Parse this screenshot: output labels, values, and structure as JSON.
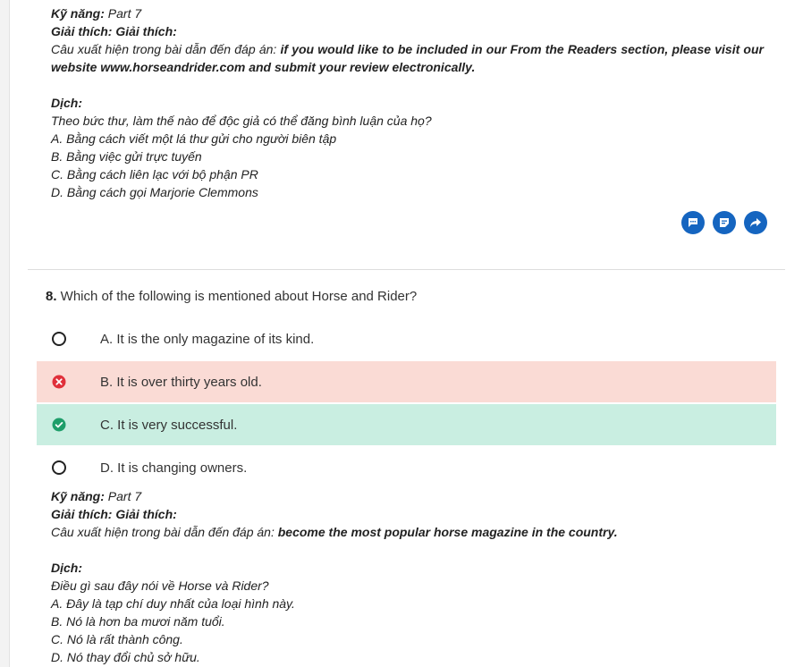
{
  "q7_explain": {
    "skill_label": "Kỹ năng:",
    "skill_value": " Part 7",
    "explain_label": "Giải thích: Giải thích:",
    "evidence_prefix": "Câu xuất hiện trong bài dẫn đến đáp án: ",
    "evidence_text": "if you would like to be included in our From the Readers section, please visit our website www.horseandrider.com and submit your review electronically.",
    "translation_label": "Dịch:",
    "translation_lines": [
      "Theo bức thư, làm thế nào để độc giả có thể đăng bình luận của họ?",
      "A. Bằng cách viết một lá thư gửi cho người biên tập",
      "B. Bằng việc gửi trực tuyến",
      "C. Bằng cách liên lạc với bộ phận PR",
      "D. Bằng cách gọi Marjorie Clemmons"
    ]
  },
  "actions": {
    "icons": [
      "comment-icon",
      "note-icon",
      "share-icon"
    ],
    "color": "#1565c0"
  },
  "question8": {
    "number": "8.",
    "text": " Which of the following is mentioned about Horse and Rider?",
    "options": [
      {
        "label": "A. It is the only magazine of its kind.",
        "state": "unselected"
      },
      {
        "label": "B. It is over thirty years old.",
        "state": "wrong"
      },
      {
        "label": "C. It is very successful.",
        "state": "correct"
      },
      {
        "label": "D. It is changing owners.",
        "state": "unselected"
      }
    ],
    "colors": {
      "wrong_bg": "#fadbd5",
      "correct_bg": "#c9eee1",
      "wrong_icon": "#e0303a",
      "correct_icon": "#1e9e6a"
    }
  },
  "q8_explain": {
    "skill_label": "Kỹ năng:",
    "skill_value": " Part 7",
    "explain_label": "Giải thích: Giải thích:",
    "evidence_prefix": "Câu xuất hiện trong bài dẫn đến đáp án: ",
    "evidence_text": "become the most popular horse magazine in the country.",
    "translation_label": "Dịch:",
    "translation_lines": [
      "Điều gì sau đây nói về Horse và Rider?",
      "A. Đây là tạp chí duy nhất của loại hình này.",
      "B. Nó là hơn ba mươi năm tuổi.",
      "C. Nó là rất thành công.",
      "D. Nó thay đổi chủ sở hữu."
    ]
  }
}
